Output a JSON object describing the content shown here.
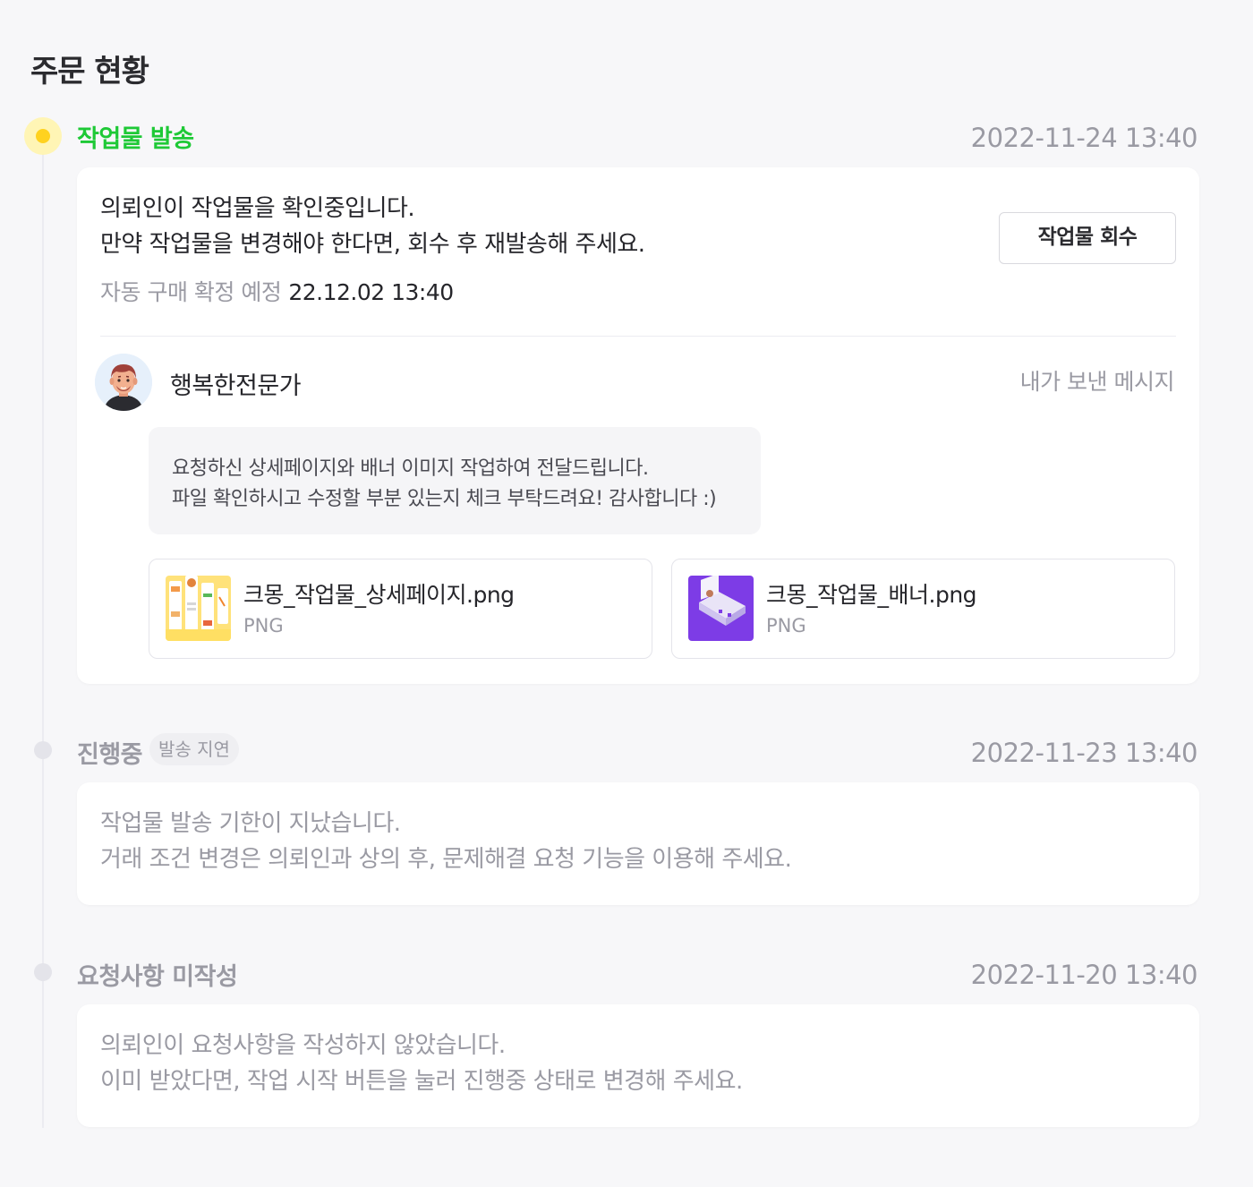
{
  "page_title": "주문 현황",
  "steps": [
    {
      "title": "작업물 발송",
      "date": "2022-11-24 13:40",
      "message_line1": "의뢰인이 작업물을 확인중입니다.",
      "message_line2": "만약 작업물을 변경해야 한다면, 회수 후 재발송해 주세요.",
      "auto_confirm_label": "자동 구매 확정 예정",
      "auto_confirm_value": "22.12.02 13:40",
      "recall_button": "작업물 회수",
      "sender_name": "행복한전문가",
      "sent_label": "내가 보낸 메시지",
      "bubble_line1": "요청하신 상세페이지와 배너 이미지 작업하여 전달드립니다.",
      "bubble_line2": "파일 확인하시고 수정할 부분 있는지 체크 부탁드려요! 감사합니다 :)",
      "files": [
        {
          "name": "크몽_작업물_상세페이지.png",
          "type": "PNG"
        },
        {
          "name": "크몽_작업물_배너.png",
          "type": "PNG"
        }
      ]
    },
    {
      "title": "진행중",
      "badge": "발송 지연",
      "date": "2022-11-23 13:40",
      "message_line1": "작업물 발송 기한이 지났습니다.",
      "message_line2": "거래 조건 변경은 의뢰인과 상의 후, 문제해결 요청 기능을 이용해 주세요."
    },
    {
      "title": "요청사항 미작성",
      "date": "2022-11-20 13:40",
      "message_line1": "의뢰인이 요청사항을 작성하지 않았습니다.",
      "message_line2": "이미 받았다면, 작업 시작 버튼을 눌러 진행중 상태로 변경해 주세요."
    }
  ],
  "colors": {
    "active_green": "#1ec936",
    "active_dot": "#ffd21f",
    "active_dot_halo": "#fff5b5",
    "muted_text": "#9a9aa3",
    "background": "#f7f7f9"
  }
}
